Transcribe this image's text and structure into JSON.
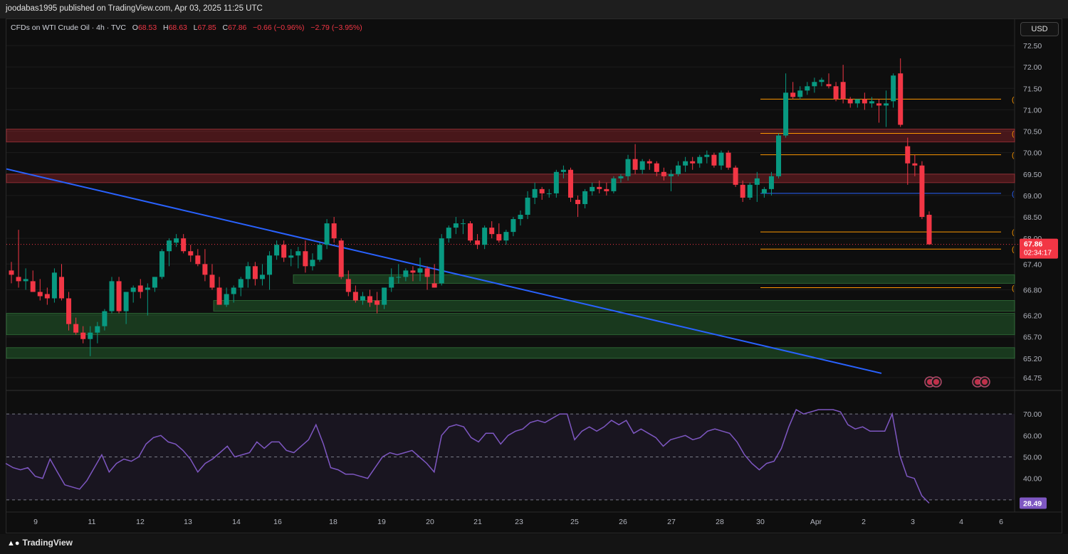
{
  "header": {
    "published_by": "joodabas1995 published on TradingView.com, Apr 03, 2025 11:25 UTC"
  },
  "legend": {
    "symbol": "CFDs on WTI Crude Oil · 4h · TVC",
    "o_label": "O",
    "o": "68.53",
    "h_label": "H",
    "h": "68.63",
    "l_label": "L",
    "l": "67.85",
    "c_label": "C",
    "c": "67.86",
    "change": "−0.66 (−0.96%)",
    "change2": "−2.79 (−3.95%)"
  },
  "currency": "USD",
  "price_tag": {
    "price": "67.86",
    "countdown": "02:34:17"
  },
  "rsi_tag": "28.49",
  "footer": {
    "brand": "TradingView"
  },
  "colors": {
    "up": "#089981",
    "down": "#f23645",
    "trendline": "#2962ff",
    "rsi": "#7e57c2",
    "fib": "#ff9800"
  },
  "chart_data": [
    {
      "type": "candlestick",
      "title": "CFDs on WTI Crude Oil · 4h · TVC",
      "y_ticks": [
        "72.50",
        "72.00",
        "71.50",
        "71.00",
        "70.50",
        "70.00",
        "69.50",
        "69.00",
        "68.50",
        "68.00",
        "67.40",
        "66.80",
        "66.20",
        "65.70",
        "65.20",
        "64.75"
      ],
      "x_ticks": [
        "9",
        "11",
        "12",
        "13",
        "14",
        "16",
        "18",
        "19",
        "20",
        "21",
        "23",
        "25",
        "26",
        "27",
        "28",
        "30",
        "Apr",
        "2",
        "3",
        "4",
        "6"
      ],
      "ylim": [
        64.6,
        72.7
      ],
      "candles": [
        [
          67.25,
          67.45,
          66.95,
          67.15
        ],
        [
          67.1,
          68.2,
          66.85,
          67.0
        ],
        [
          67.0,
          67.3,
          66.8,
          67.05
        ],
        [
          67.0,
          67.25,
          66.75,
          66.75
        ],
        [
          66.75,
          67.05,
          66.55,
          66.65
        ],
        [
          66.7,
          66.85,
          66.45,
          66.6
        ],
        [
          66.6,
          67.3,
          66.5,
          67.2
        ],
        [
          67.1,
          67.4,
          66.55,
          66.6
        ],
        [
          66.6,
          66.75,
          65.85,
          66.0
        ],
        [
          66.0,
          66.15,
          65.75,
          65.8
        ],
        [
          65.8,
          65.95,
          65.55,
          65.65
        ],
        [
          65.65,
          65.95,
          65.25,
          65.8
        ],
        [
          65.8,
          66.05,
          65.55,
          65.95
        ],
        [
          65.95,
          66.35,
          65.85,
          66.3
        ],
        [
          66.3,
          67.1,
          66.25,
          67.0
        ],
        [
          67.0,
          67.1,
          66.25,
          66.3
        ],
        [
          66.3,
          66.75,
          66.0,
          66.75
        ],
        [
          66.75,
          66.9,
          66.5,
          66.85
        ],
        [
          66.9,
          67.05,
          66.6,
          66.75
        ],
        [
          66.8,
          66.95,
          66.2,
          66.85
        ],
        [
          66.85,
          67.1,
          66.75,
          67.1
        ],
        [
          67.1,
          67.75,
          67.05,
          67.7
        ],
        [
          67.7,
          68.0,
          67.35,
          67.95
        ],
        [
          67.9,
          68.1,
          67.8,
          68.0
        ],
        [
          68.0,
          68.1,
          67.65,
          67.7
        ],
        [
          67.7,
          67.85,
          67.45,
          67.6
        ],
        [
          67.6,
          67.75,
          67.35,
          67.4
        ],
        [
          67.4,
          67.75,
          67.0,
          67.15
        ],
        [
          67.15,
          67.4,
          66.8,
          66.85
        ],
        [
          66.85,
          67.1,
          66.45,
          66.45
        ],
        [
          66.45,
          66.85,
          66.4,
          66.7
        ],
        [
          66.7,
          66.9,
          66.5,
          66.85
        ],
        [
          66.85,
          67.1,
          66.65,
          67.05
        ],
        [
          67.05,
          67.45,
          66.85,
          67.35
        ],
        [
          67.35,
          67.45,
          66.9,
          67.05
        ],
        [
          67.05,
          67.4,
          66.9,
          67.15
        ],
        [
          67.15,
          67.7,
          66.8,
          67.6
        ],
        [
          67.6,
          67.95,
          67.5,
          67.85
        ],
        [
          67.85,
          67.95,
          67.45,
          67.55
        ],
        [
          67.55,
          67.75,
          67.35,
          67.6
        ],
        [
          67.6,
          67.8,
          67.3,
          67.7
        ],
        [
          67.7,
          67.95,
          67.2,
          67.35
        ],
        [
          67.35,
          67.65,
          67.25,
          67.5
        ],
        [
          67.5,
          67.9,
          67.45,
          67.85
        ],
        [
          67.85,
          68.45,
          67.75,
          68.35
        ],
        [
          68.35,
          68.5,
          67.9,
          68.0
        ],
        [
          67.95,
          68.0,
          67.05,
          67.1
        ],
        [
          67.05,
          67.25,
          66.65,
          66.75
        ],
        [
          66.75,
          66.9,
          66.5,
          66.55
        ],
        [
          66.55,
          66.75,
          66.45,
          66.65
        ],
        [
          66.65,
          66.8,
          66.4,
          66.5
        ],
        [
          66.55,
          66.75,
          66.25,
          66.45
        ],
        [
          66.45,
          66.85,
          66.35,
          66.85
        ],
        [
          66.85,
          67.3,
          66.75,
          67.1
        ],
        [
          67.1,
          67.4,
          66.95,
          67.1
        ],
        [
          67.1,
          67.3,
          67.0,
          67.25
        ],
        [
          67.25,
          67.35,
          67.0,
          67.2
        ],
        [
          67.2,
          67.55,
          67.0,
          67.3
        ],
        [
          67.3,
          67.35,
          66.8,
          67.1
        ],
        [
          66.95,
          67.4,
          66.85,
          66.85
        ],
        [
          66.95,
          68.1,
          66.9,
          68.0
        ],
        [
          68.0,
          68.3,
          67.9,
          68.25
        ],
        [
          68.25,
          68.5,
          68.1,
          68.35
        ],
        [
          68.35,
          68.45,
          68.1,
          68.35
        ],
        [
          68.35,
          68.4,
          67.9,
          67.95
        ],
        [
          67.95,
          68.1,
          67.75,
          67.85
        ],
        [
          67.85,
          68.3,
          67.75,
          68.25
        ],
        [
          68.25,
          68.4,
          68.0,
          68.1
        ],
        [
          68.1,
          68.35,
          67.9,
          67.95
        ],
        [
          67.95,
          68.2,
          67.85,
          68.15
        ],
        [
          68.15,
          68.5,
          68.05,
          68.45
        ],
        [
          68.45,
          68.65,
          68.3,
          68.55
        ],
        [
          68.55,
          69.1,
          68.45,
          68.95
        ],
        [
          68.95,
          69.3,
          68.8,
          69.15
        ],
        [
          69.15,
          69.2,
          68.9,
          69.05
        ],
        [
          69.05,
          69.15,
          68.95,
          69.05
        ],
        [
          69.05,
          69.6,
          68.95,
          69.55
        ],
        [
          69.55,
          69.7,
          69.4,
          69.6
        ],
        [
          69.6,
          69.65,
          68.85,
          68.95
        ],
        [
          68.9,
          69.0,
          68.5,
          68.8
        ],
        [
          68.8,
          69.15,
          68.7,
          69.1
        ],
        [
          69.1,
          69.3,
          69.0,
          69.2
        ],
        [
          69.2,
          69.35,
          69.05,
          69.15
        ],
        [
          69.15,
          69.3,
          69.0,
          69.1
        ],
        [
          69.1,
          69.45,
          69.05,
          69.4
        ],
        [
          69.4,
          69.5,
          69.3,
          69.45
        ],
        [
          69.45,
          69.95,
          69.35,
          69.85
        ],
        [
          69.85,
          70.2,
          69.5,
          69.6
        ],
        [
          69.6,
          69.85,
          69.5,
          69.8
        ],
        [
          69.8,
          69.85,
          69.6,
          69.75
        ],
        [
          69.75,
          69.8,
          69.45,
          69.55
        ],
        [
          69.55,
          69.65,
          69.35,
          69.45
        ],
        [
          69.45,
          69.6,
          69.1,
          69.5
        ],
        [
          69.5,
          69.8,
          69.45,
          69.7
        ],
        [
          69.7,
          69.9,
          69.55,
          69.8
        ],
        [
          69.8,
          69.9,
          69.6,
          69.75
        ],
        [
          69.75,
          69.95,
          69.65,
          69.9
        ],
        [
          69.9,
          70.05,
          69.75,
          69.95
        ],
        [
          69.95,
          70.0,
          69.65,
          69.7
        ],
        [
          69.7,
          70.05,
          69.6,
          70.0
        ],
        [
          70.0,
          70.05,
          69.6,
          69.65
        ],
        [
          69.65,
          69.7,
          69.2,
          69.25
        ],
        [
          69.25,
          69.35,
          68.85,
          68.95
        ],
        [
          68.95,
          69.3,
          68.9,
          69.25
        ],
        [
          69.25,
          69.55,
          68.85,
          69.4
        ],
        [
          69.05,
          69.2,
          68.95,
          69.15
        ],
        [
          69.15,
          69.55,
          69.0,
          69.45
        ],
        [
          69.45,
          70.45,
          69.4,
          70.4
        ],
        [
          70.4,
          71.85,
          70.35,
          71.4
        ],
        [
          71.4,
          71.65,
          71.25,
          71.3
        ],
        [
          71.3,
          71.55,
          71.25,
          71.45
        ],
        [
          71.45,
          71.65,
          71.35,
          71.55
        ],
        [
          71.55,
          71.75,
          71.4,
          71.65
        ],
        [
          71.65,
          71.75,
          71.55,
          71.7
        ],
        [
          71.6,
          71.85,
          71.5,
          71.55
        ],
        [
          71.55,
          71.65,
          71.2,
          71.25
        ],
        [
          71.65,
          72.05,
          71.15,
          71.25
        ],
        [
          71.25,
          71.3,
          71.05,
          71.15
        ],
        [
          71.15,
          71.25,
          71.05,
          71.25
        ],
        [
          71.25,
          71.4,
          71.0,
          71.15
        ],
        [
          71.15,
          71.3,
          71.05,
          71.2
        ],
        [
          71.15,
          71.25,
          70.7,
          71.1
        ],
        [
          71.1,
          71.45,
          70.6,
          71.15
        ],
        [
          71.2,
          71.85,
          71.05,
          71.8
        ],
        [
          71.85,
          72.2,
          70.6,
          70.65
        ],
        [
          70.15,
          70.35,
          69.25,
          69.75
        ],
        [
          69.75,
          69.95,
          69.45,
          69.7
        ],
        [
          69.7,
          69.8,
          68.45,
          68.5
        ],
        [
          68.55,
          68.63,
          67.85,
          67.86
        ]
      ],
      "horizontal_levels": [
        "71.25",
        "70.45",
        "69.95",
        "69.05",
        "68.15",
        "67.75",
        "66.85"
      ],
      "zones": [
        [
          "70.25",
          "70.55",
          "resistance"
        ],
        [
          "69.3",
          "69.5",
          "resistance"
        ],
        [
          "66.95",
          "67.15",
          "support"
        ],
        [
          "66.3",
          "66.55",
          "support"
        ],
        [
          "65.75",
          "66.25",
          "support"
        ],
        [
          "65.2",
          "65.45",
          "support"
        ]
      ]
    },
    {
      "type": "line",
      "title": "RSI",
      "y_ticks": [
        "70.00",
        "60.00",
        "50.00",
        "40.00",
        "30.00"
      ],
      "ylim": [
        27,
        74
      ],
      "bands": [
        "70",
        "50",
        "30"
      ],
      "values": [
        47,
        45,
        44,
        45,
        41,
        40,
        49,
        43,
        37,
        36,
        35,
        39,
        45,
        51,
        43,
        47,
        49,
        48,
        50,
        56,
        59,
        60,
        57,
        56,
        53,
        49,
        43,
        47,
        49,
        52,
        55,
        50,
        51,
        52,
        57,
        54,
        57,
        57,
        53,
        52,
        55,
        58,
        65,
        56,
        45,
        44,
        42,
        42,
        41,
        40,
        45,
        50,
        52,
        51,
        52,
        53,
        50,
        47,
        43,
        60,
        64,
        65,
        64,
        59,
        57,
        61,
        61,
        56,
        60,
        62,
        63,
        66,
        67,
        66,
        68,
        70,
        70,
        58,
        62,
        64,
        62,
        64,
        67,
        65,
        67,
        61,
        63,
        61,
        59,
        55,
        58,
        59,
        60,
        58,
        59,
        62,
        63,
        62,
        61,
        57,
        51,
        47,
        44,
        47,
        48,
        54,
        64,
        72,
        70,
        71,
        72,
        72,
        72,
        71,
        65,
        63,
        64,
        62,
        62,
        62,
        70,
        51,
        41,
        40,
        32,
        28.49
      ]
    }
  ]
}
